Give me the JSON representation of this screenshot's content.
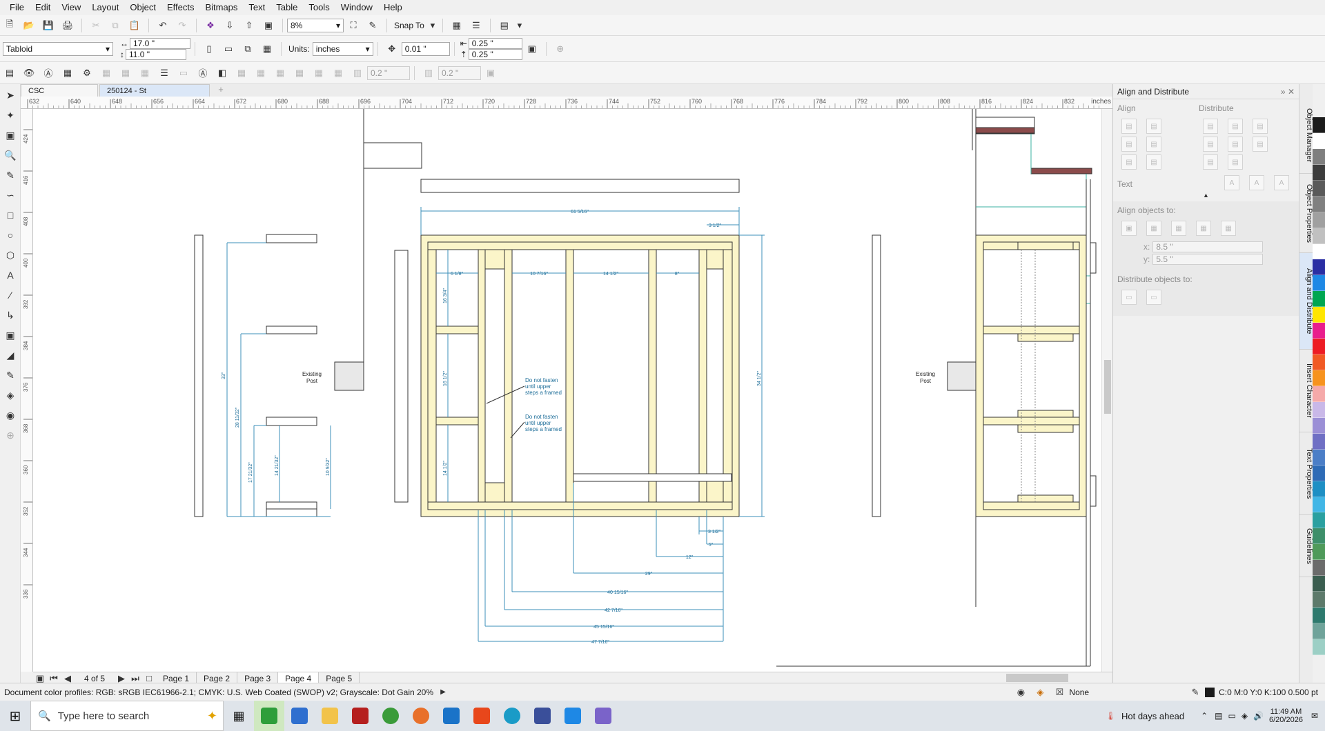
{
  "menu": [
    "File",
    "Edit",
    "View",
    "Layout",
    "Object",
    "Effects",
    "Bitmaps",
    "Text",
    "Table",
    "Tools",
    "Window",
    "Help"
  ],
  "toolbar1": {
    "zoom": "8%",
    "snap_to": "Snap To"
  },
  "toolbar2": {
    "page_size": "Tabloid",
    "width": "17.0 \"",
    "height": "11.0 \"",
    "units_label": "Units:",
    "units_value": "inches",
    "nudge": "0.01 \"",
    "dup_x": "0.25 \"",
    "dup_y": "0.25 \""
  },
  "toolbar3": {
    "val1": "0.2 \"",
    "val2": "0.2 \""
  },
  "doc_tabs": [
    "CSC",
    "250124 - St"
  ],
  "ruler": {
    "h_ticks": [
      "632",
      "640",
      "648",
      "656",
      "664",
      "672",
      "680",
      "688",
      "696",
      "704",
      "712",
      "720",
      "728",
      "736",
      "744",
      "752",
      "760",
      "768",
      "776",
      "784",
      "792",
      "800",
      "808",
      "816",
      "824",
      "832"
    ],
    "unit": "inches",
    "v_ticks": [
      "424",
      "416",
      "408",
      "400",
      "392",
      "384",
      "376",
      "368",
      "360",
      "352",
      "344",
      "336"
    ]
  },
  "drawing": {
    "existing_post_1": "Existing",
    "existing_post_2": "Post",
    "dims": {
      "top": "61 5/16\"",
      "r1": "3 1/2\"",
      "a": "6 1/8\"",
      "b": "10 7/16\"",
      "c": "14 1/2\"",
      "d": "8\"",
      "vl1": "16 3/4\"",
      "vl2": "16 1/2\"",
      "vl3": "14 1/2\"",
      "right_h": "34 1/2\"",
      "left_h": "33\"",
      "lh2": "28 11/32\"",
      "lh3": "17 21/32\"",
      "lh4": "14 21/32\"",
      "lh5": "10 9/32\"",
      "bot1": "3 1/2\"",
      "bot2": "5\"",
      "bot3": "12\"",
      "bot4": "29\"",
      "bot5": "40 15/16\"",
      "bot6": "42 7/16\"",
      "bot7": "45 15/16\"",
      "bot8": "47 7/16\""
    },
    "note1": [
      "Do not fasten",
      "until upper",
      "steps a framed"
    ],
    "note2": [
      "Do not fasten",
      "until upper",
      "steps a framed"
    ]
  },
  "page_nav": {
    "counter": "4 of 5",
    "pages": [
      "Page 1",
      "Page 2",
      "Page 3",
      "Page 4",
      "Page 5"
    ],
    "active": "Page 4"
  },
  "panel": {
    "title": "Align and Distribute",
    "align": "Align",
    "distribute": "Distribute",
    "text": "Text",
    "align_to": "Align objects to:",
    "x_label": "x:",
    "x_value": "8.5 \"",
    "y_label": "y:",
    "y_value": "5.5 \"",
    "distribute_to": "Distribute objects to:"
  },
  "docker_tabs": [
    "Object Manager",
    "Object Properties",
    "Align and Distribute",
    "Insert Character",
    "Text Properties",
    "Guidelines"
  ],
  "palette": [
    "#1b1b1b",
    "#ffffff",
    "#7f7f7f",
    "#3c3c3c",
    "#5a5a5a",
    "#808080",
    "#a0a0a0",
    "#c0c0c0",
    "#ffffff",
    "#2a2ea3",
    "#1e88e5",
    "#00a651",
    "#ffe600",
    "#e91e8c",
    "#ed1c24",
    "#f15a24",
    "#f7931e",
    "#f5a9a9",
    "#c9b8e8",
    "#9b8fd6",
    "#6f6fc4",
    "#4b7ec7",
    "#2e6bb6",
    "#1e8fc4",
    "#41b6e6",
    "#2aa0a0",
    "#3d8f6a",
    "#4f9a5a",
    "#6b6b6b",
    "#3b5e50",
    "#5d7a6b",
    "#2e7a6e",
    "#6fa39a",
    "#9ccfc5"
  ],
  "status": {
    "profiles": "Document color profiles: RGB: sRGB IEC61966-2.1; CMYK: U.S. Web Coated (SWOP) v2; Grayscale: Dot Gain 20%",
    "fill": "None",
    "outline": "C:0 M:0 Y:0 K:100  0.500 pt"
  },
  "taskbar": {
    "search_placeholder": "Type here to search",
    "weather": "Hot days ahead",
    "time": "11:49 AM",
    "date": "6/20/2026"
  }
}
